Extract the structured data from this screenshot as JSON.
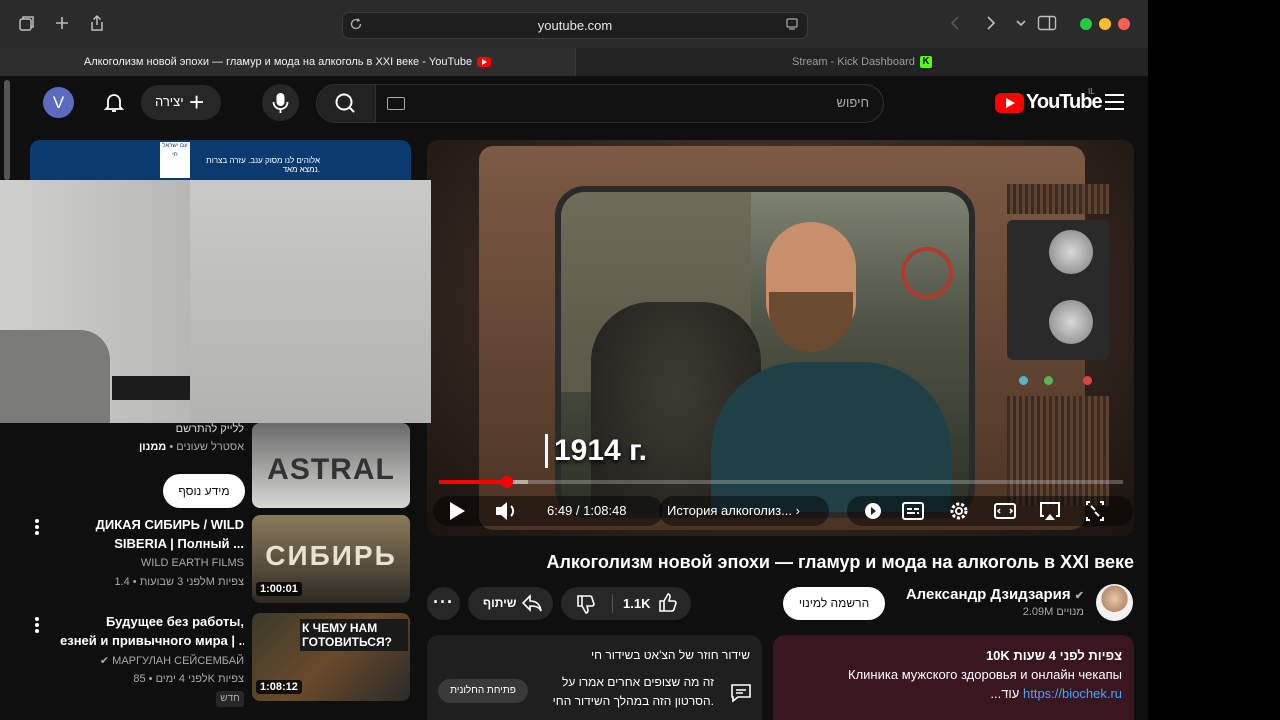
{
  "browser": {
    "url": "youtube.com",
    "tabs": [
      {
        "label": "Алкоголизм новой эпохи — гламур и мода на алкоголь в XXI веке - YouTube",
        "active": true
      },
      {
        "label": "Stream - Kick Dashboard",
        "active": false
      }
    ]
  },
  "header": {
    "avatar_letter": "V",
    "create_label": "יצירה",
    "search_placeholder": "חיפוש",
    "logo_text": "YouTube",
    "logo_region": "IL"
  },
  "ad": {
    "logo_text": "עם ישראל חי",
    "text": "אלוהים לנו מסוק ענב. עזרה בצרות נמצא מאד."
  },
  "player": {
    "overlay_year": "1914 г.",
    "current_time": "6:49",
    "duration": "1:08:48",
    "time_display": "6:49 / 1:08:48",
    "chapter": "История алкоголиз...",
    "progress_played": 0.1,
    "progress_loaded": 0.13
  },
  "sidebar": {
    "partial": {
      "line1": "ללייק להתרשם",
      "channel": "ממנון",
      "meta": "אסטרל שעונים",
      "more_info_label": "מידע נוסף",
      "thumb_text": "ASTRAL"
    },
    "items": [
      {
        "title_line1": "ДИКАЯ СИБИРЬ / WILD",
        "title_line2": "SIBERIA | Полный ...",
        "channel": "WILD EARTH FILMS",
        "views": "1.4M צפיות",
        "age": "לפני 3 שבועות",
        "duration": "1:00:01",
        "thumb_text": "СИБИРЬ"
      },
      {
        "title_line1": "Будущее без работы,",
        "title_line2": "езней и привычного мира | ...",
        "channel": "МАРГУЛАН СЕЙСЕМБАЙ",
        "views": "85K צפיות",
        "age": "לפני 4 ימים",
        "badge": "חדש",
        "duration": "1:08:12",
        "thumb_text": "К ЧЕМУ НАМ ГОТОВИТЬСЯ?"
      }
    ]
  },
  "video": {
    "title": "Алкоголизм новой эпохи — гламур и мода на алкоголь в XXI веке",
    "channel_name": "Александр Дзидзария",
    "subscribers": "2.09M מנויים",
    "subscribe_label": "הרשמה למינוי",
    "like_count": "1.1K",
    "share_label": "שיתוף",
    "description": {
      "stats": "10K צפיות  לפני 4 שעות",
      "line2": "Клиника мужского здоровья  и онлайн чекапы",
      "link": "https://biochek.ru",
      "more": "...עוד"
    },
    "chat": {
      "header": "שידור חוזר של הצ'אט בשידור חי",
      "desc1": "זה מה שצופים אחרים אמרו על",
      "desc2": "הסרטון הזה במהלך השידור החי.",
      "open_label": "פתיחת החלונית"
    }
  },
  "colors": {
    "bg": "#0f0f0f",
    "accent_red": "#ff0000",
    "link": "#3ea6ff",
    "kick_green": "#53fc18"
  }
}
